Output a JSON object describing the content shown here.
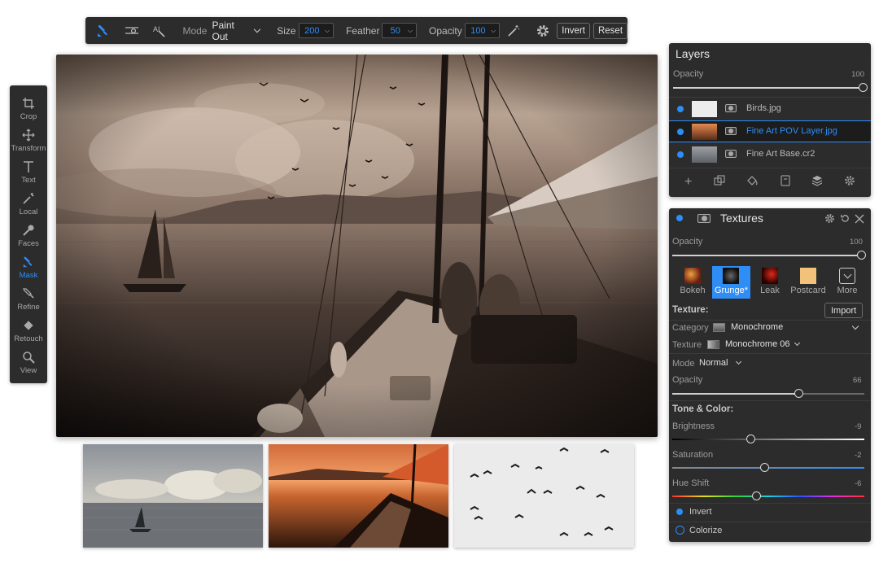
{
  "toolbar": {
    "mode_label": "Mode",
    "mode_value": "Paint Out",
    "size_label": "Size",
    "size_value": "200",
    "feather_label": "Feather",
    "feather_value": "50",
    "opacity_label": "Opacity",
    "opacity_value": "100",
    "invert_label": "Invert",
    "reset_label": "Reset",
    "icons": [
      "mask-brush-icon",
      "mask-adjust-icon",
      "mask-ai-icon",
      "magic-wand-icon",
      "gear-icon"
    ]
  },
  "left_tools": [
    {
      "label": "Crop",
      "icon": "crop-icon"
    },
    {
      "label": "Transform",
      "icon": "move-icon"
    },
    {
      "label": "Text",
      "icon": "text-icon"
    },
    {
      "label": "Local",
      "icon": "local-brush-icon"
    },
    {
      "label": "Faces",
      "icon": "faces-brush-icon"
    },
    {
      "label": "Mask",
      "icon": "mask-brush-icon",
      "active": true
    },
    {
      "label": "Refine",
      "icon": "refine-brush-icon"
    },
    {
      "label": "Retouch",
      "icon": "retouch-icon"
    },
    {
      "label": "View",
      "icon": "zoom-icon"
    }
  ],
  "layers": {
    "title": "Layers",
    "opacity_label": "Opacity",
    "opacity_value": "100",
    "opacity_level": 1.0,
    "items": [
      {
        "name": "Birds.jpg",
        "selected": false
      },
      {
        "name": "Fine Art POV Layer.jpg",
        "selected": true
      },
      {
        "name": "Fine Art Base.cr2",
        "selected": false
      }
    ],
    "footer_icons": [
      "add-icon",
      "duplicate-icon",
      "fill-icon",
      "copy-icon",
      "stack-icon",
      "settings-icon"
    ]
  },
  "textures": {
    "title": "Textures",
    "opacity_label": "Opacity",
    "opacity_value": "100",
    "opacity_level": 1.0,
    "categories": [
      {
        "label": "Bokeh",
        "selected": false
      },
      {
        "label": "Grunge*",
        "selected": true
      },
      {
        "label": "Leak",
        "selected": false
      },
      {
        "label": "Postcard",
        "selected": false
      },
      {
        "label": "More",
        "selected": false
      }
    ],
    "texture_heading": "Texture:",
    "import_label": "Import",
    "category_label": "Category",
    "category_value": "Monochrome",
    "texture_label": "Texture",
    "texture_value": "Monochrome 06",
    "mode_label": "Mode",
    "mode_value": "Normal",
    "opacity2_label": "Opacity",
    "opacity2_value": "66",
    "opacity2_level": 0.66,
    "tone_heading": "Tone & Color:",
    "brightness_label": "Brightness",
    "brightness_value": "-9",
    "brightness_level": 0.41,
    "saturation_label": "Saturation",
    "saturation_value": "-2",
    "saturation_level": 0.48,
    "hue_label": "Hue Shift",
    "hue_value": "-6",
    "hue_level": 0.44,
    "invert_label": "Invert",
    "invert_checked": true,
    "colorize_label": "Colorize",
    "colorize_checked": false
  },
  "colors": {
    "accent": "#2f8df6",
    "panel_bg": "#2c2c2d"
  }
}
